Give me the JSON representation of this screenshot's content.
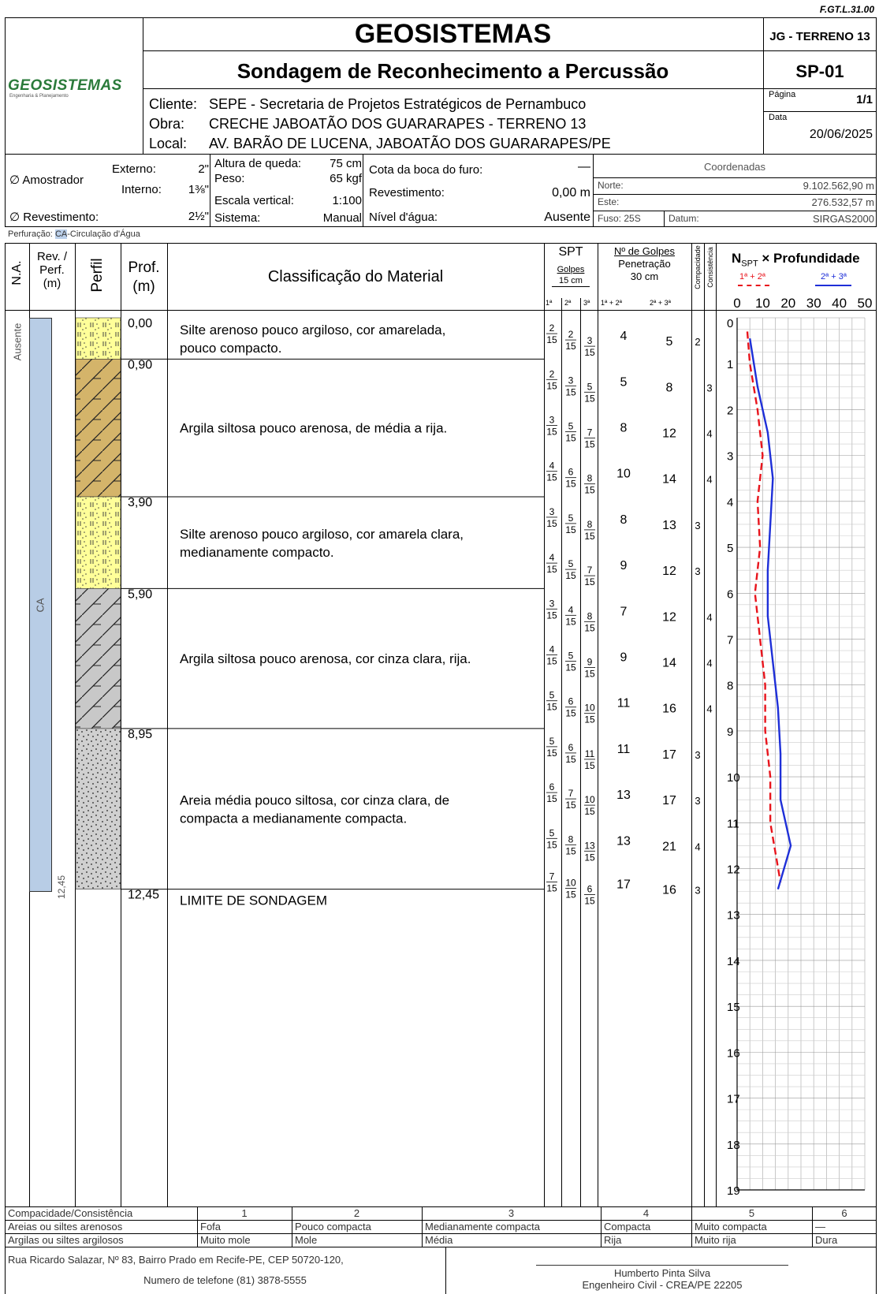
{
  "doc_code": "F.GT.L.31.00",
  "company": "GEOSISTEMAS",
  "logo_text": "GEOSISTEMAS",
  "logo_sub": "Engenharia & Planejamento",
  "project_code": "JG - TERRENO 13",
  "subtitle": "Sondagem de Reconhecimento a Percussão",
  "hole_id": "SP-01",
  "page": {
    "label": "Página",
    "value": "1/1"
  },
  "date": {
    "label": "Data",
    "value": "20/06/2025"
  },
  "client": {
    "label": "Cliente:",
    "value": "SEPE - Secretaria de Projetos Estratégicos de Pernambuco"
  },
  "work": {
    "label": "Obra:",
    "value": "CRECHE JABOATÃO DOS GUARARAPES - TERRENO 13"
  },
  "location": {
    "label": "Local:",
    "value": "AV. BARÃO DE LUCENA, JABOATÃO DOS GUARARAPES/PE"
  },
  "sampler": {
    "label": "∅ Amostrador",
    "ext_label": "Externo:",
    "ext_value": "2\"",
    "int_label": "Interno:",
    "int_value": "1⅜\""
  },
  "casing": {
    "label": "∅ Revestimento:",
    "value": "2½\""
  },
  "fall": {
    "label": "Altura de queda:",
    "value": "75 cm"
  },
  "weight": {
    "label": "Peso:",
    "value": "65 kgf"
  },
  "scale": {
    "label": "Escala vertical:",
    "value": "1:100"
  },
  "system": {
    "label": "Sistema:",
    "value": "Manual"
  },
  "elevation": {
    "label": "Cota da boca do furo:",
    "value": "—"
  },
  "casing_depth": {
    "label": "Revestimento:",
    "value": "0,00 m"
  },
  "water": {
    "label": "Nível d'água:",
    "value": "Ausente"
  },
  "coords": {
    "title": "Coordenadas",
    "north_label": "Norte:",
    "north": "9.102.562,90 m",
    "east_label": "Este:",
    "east": "276.532,57 m",
    "zone_label": "Fuso: 25S",
    "datum_label": "Datum:",
    "datum": "SIRGAS2000"
  },
  "drilling": {
    "prefix": "Perfuração:",
    "code": "CA",
    "text": "-Circulação d'Água"
  },
  "headers": {
    "na": "N.A.",
    "rev1": "Rev. /",
    "rev2": "Perf.",
    "rev3": "(m)",
    "perfil": "Perfil",
    "prof1": "Prof.",
    "prof2": "(m)",
    "class": "Classificação do Material",
    "spt": "SPT",
    "golpes": "Golpes",
    "cm15": "15 cm",
    "g1": "1ª",
    "g2": "2ª",
    "g3": "3ª",
    "ng1": "Nº de Golpes",
    "ng2": "Penetração",
    "ng3": "30 cm",
    "c12": "1ª + 2ª",
    "c23": "2ª + 3ª",
    "compac": "Compacidade",
    "consist": "Consistência",
    "nspt": "N",
    "nspt_sub": "SPT",
    "nspt_rest": " × Profundidade",
    "leg12": "1ª + 2ª",
    "leg23": "2ª + 3ª"
  },
  "na_value": "Ausente",
  "rev_value": "CA",
  "final_depth": "12,45",
  "layers": [
    {
      "top": 0,
      "bottom": 0.9,
      "top_label": "0,00",
      "desc": [
        "Silte arenoso pouco argiloso, cor amarelada,",
        "pouco compacto."
      ],
      "pattern": "silt"
    },
    {
      "top": 0.9,
      "bottom": 3.9,
      "top_label": "0,90",
      "desc": [
        "Argila siltosa pouco arenosa, de média a rija."
      ],
      "pattern": "clay-brown"
    },
    {
      "top": 3.9,
      "bottom": 5.9,
      "top_label": "3,90",
      "desc": [
        "Silte arenoso pouco argiloso, cor amarela clara,",
        "medianamente compacto."
      ],
      "pattern": "silt"
    },
    {
      "top": 5.9,
      "bottom": 8.95,
      "top_label": "5,90",
      "desc": [
        "Argila siltosa pouco arenosa, cor cinza clara, rija."
      ],
      "pattern": "clay-gray"
    },
    {
      "top": 8.95,
      "bottom": 12.45,
      "top_label": "8,95",
      "desc": [
        "Areia média pouco siltosa, cor cinza clara, de",
        "compacta a medianamente compacta."
      ],
      "pattern": "sand"
    },
    {
      "top": 12.45,
      "bottom": 12.45,
      "top_label": "12,45",
      "desc": [
        "LIMITE DE SONDAGEM"
      ],
      "pattern": "none"
    }
  ],
  "spt_label": "15",
  "spt": [
    {
      "d": 0.5,
      "g": [
        2,
        2,
        3
      ],
      "n12": 4,
      "n23": 5,
      "cc": 2,
      "side": "L"
    },
    {
      "d": 1.5,
      "g": [
        2,
        3,
        5
      ],
      "n12": 5,
      "n23": 8,
      "cc": 3,
      "side": "R"
    },
    {
      "d": 2.5,
      "g": [
        3,
        5,
        7
      ],
      "n12": 8,
      "n23": 12,
      "cc": 4,
      "side": "R"
    },
    {
      "d": 3.5,
      "g": [
        4,
        6,
        8
      ],
      "n12": 10,
      "n23": 14,
      "cc": 4,
      "side": "R"
    },
    {
      "d": 4.5,
      "g": [
        3,
        5,
        8
      ],
      "n12": 8,
      "n23": 13,
      "cc": 3,
      "side": "L"
    },
    {
      "d": 5.5,
      "g": [
        4,
        5,
        7
      ],
      "n12": 9,
      "n23": 12,
      "cc": 3,
      "side": "L"
    },
    {
      "d": 6.5,
      "g": [
        3,
        4,
        8
      ],
      "n12": 7,
      "n23": 12,
      "cc": 4,
      "side": "R"
    },
    {
      "d": 7.5,
      "g": [
        4,
        5,
        9
      ],
      "n12": 9,
      "n23": 14,
      "cc": 4,
      "side": "R"
    },
    {
      "d": 8.5,
      "g": [
        5,
        6,
        10
      ],
      "n12": 11,
      "n23": 16,
      "cc": 4,
      "side": "R"
    },
    {
      "d": 9.5,
      "g": [
        5,
        6,
        11
      ],
      "n12": 11,
      "n23": 17,
      "cc": 3,
      "side": "L"
    },
    {
      "d": 10.5,
      "g": [
        6,
        7,
        10
      ],
      "n12": 13,
      "n23": 17,
      "cc": 3,
      "side": "L"
    },
    {
      "d": 11.5,
      "g": [
        5,
        8,
        13
      ],
      "n12": 13,
      "n23": 21,
      "cc": 4,
      "side": "L"
    },
    {
      "d": 12.45,
      "g": [
        7,
        10,
        6
      ],
      "n12": 17,
      "n23": 16,
      "cc": 3,
      "side": "L"
    }
  ],
  "chart_data": {
    "type": "line",
    "title": "NSPT × Profundidade",
    "x_ticks": [
      "0",
      "10",
      "20",
      "30",
      "40",
      "50"
    ],
    "xlim": [
      0,
      50
    ],
    "y_ticks": [
      "0",
      "1",
      "2",
      "3",
      "4",
      "5",
      "6",
      "7",
      "8",
      "9",
      "10",
      "11",
      "12",
      "13",
      "14",
      "15",
      "16",
      "17",
      "18",
      "19"
    ],
    "ylim": [
      0,
      19
    ],
    "y_reversed": true,
    "grid": true,
    "series": [
      {
        "name": "1ª + 2ª",
        "color": "#e8141c",
        "dash": true,
        "points": [
          [
            4,
            0.3
          ],
          [
            5,
            1
          ],
          [
            8,
            2
          ],
          [
            10,
            3
          ],
          [
            8,
            4
          ],
          [
            9,
            5
          ],
          [
            7,
            6
          ],
          [
            9,
            7
          ],
          [
            11,
            8
          ],
          [
            11,
            9
          ],
          [
            13,
            10
          ],
          [
            13,
            11
          ],
          [
            17,
            12.3
          ]
        ]
      },
      {
        "name": "2ª + 3ª",
        "color": "#1e2fd8",
        "dash": false,
        "points": [
          [
            5,
            0.45
          ],
          [
            8,
            1.5
          ],
          [
            12,
            2.5
          ],
          [
            14,
            3.5
          ],
          [
            13,
            4.5
          ],
          [
            12,
            5.5
          ],
          [
            12,
            6.5
          ],
          [
            14,
            7.5
          ],
          [
            16,
            8.5
          ],
          [
            17,
            9.5
          ],
          [
            17,
            10.5
          ],
          [
            21,
            11.5
          ],
          [
            16,
            12.45
          ]
        ]
      }
    ]
  },
  "legend": {
    "row0": [
      "Compacidade/Consistência",
      "1",
      "2",
      "3",
      "4",
      "5",
      "6"
    ],
    "row1": [
      "Areias ou siltes arenosos",
      "Fofa",
      "Pouco compacta",
      "Medianamente compacta",
      "Compacta",
      "Muito compacta",
      "—"
    ],
    "row2": [
      "Argilas ou siltes argilosos",
      "Muito mole",
      "Mole",
      "Média",
      "Rija",
      "Muito rija",
      "Dura"
    ]
  },
  "footer": {
    "address": "Rua Ricardo Salazar, Nº 83, Bairro Prado em Recife-PE, CEP 50720-120,",
    "phone": "Numero de telefone (81) 3878-5555",
    "engineer": "Humberto Pinta Silva",
    "crea": "Engenheiro Civil - CREA/PE 22205"
  }
}
